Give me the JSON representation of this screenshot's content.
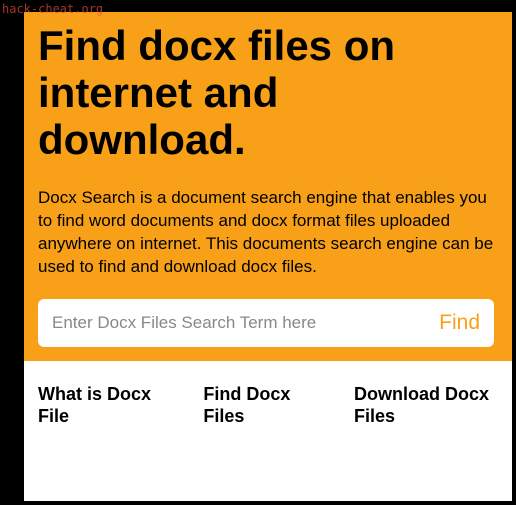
{
  "watermark": "hack-cheat.org",
  "headline": "Find docx files on internet and download.",
  "description": "Docx Search is a document search engine that enables you to find word documents and docx format files uploaded anywhere on internet. This documents search engine can be used to find and download docx files.",
  "search": {
    "placeholder": "Enter Docx Files Search Term here",
    "button_label": "Find"
  },
  "nav": {
    "items": [
      {
        "label": "What is Docx File"
      },
      {
        "label": "Find Docx Files"
      },
      {
        "label": "Download Docx Files"
      }
    ]
  }
}
